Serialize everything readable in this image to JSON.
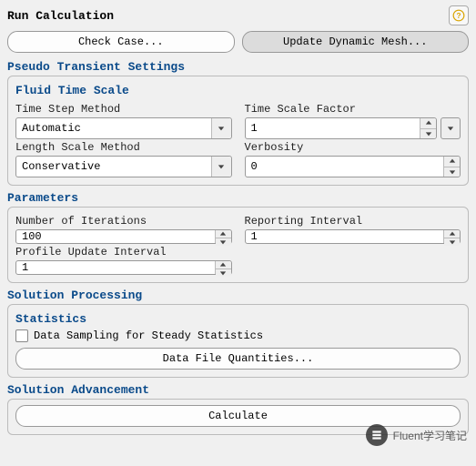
{
  "title": "Run Calculation",
  "topButtons": {
    "checkCase": "Check Case...",
    "updateMesh": "Update Dynamic Mesh..."
  },
  "pseudoTransient": {
    "label": "Pseudo Transient Settings",
    "fluidTimeScale": {
      "label": "Fluid Time Scale",
      "timeStepMethod": {
        "label": "Time Step Method",
        "value": "Automatic"
      },
      "timeScaleFactor": {
        "label": "Time Scale Factor",
        "value": "1"
      },
      "lengthScaleMethod": {
        "label": "Length Scale Method",
        "value": "Conservative"
      },
      "verbosity": {
        "label": "Verbosity",
        "value": "0"
      }
    }
  },
  "parameters": {
    "label": "Parameters",
    "numIterations": {
      "label": "Number of Iterations",
      "value": "100"
    },
    "reportingInterval": {
      "label": "Reporting Interval",
      "value": "1"
    },
    "profileUpdateInterval": {
      "label": "Profile Update Interval",
      "value": "1"
    }
  },
  "solutionProcessing": {
    "label": "Solution Processing",
    "statistics": {
      "label": "Statistics",
      "dataSampling": "Data Sampling for Steady Statistics"
    },
    "dataFileQuantities": "Data File Quantities..."
  },
  "solutionAdvancement": {
    "label": "Solution Advancement",
    "calculate": "Calculate"
  },
  "watermark": "Fluent学习笔记"
}
